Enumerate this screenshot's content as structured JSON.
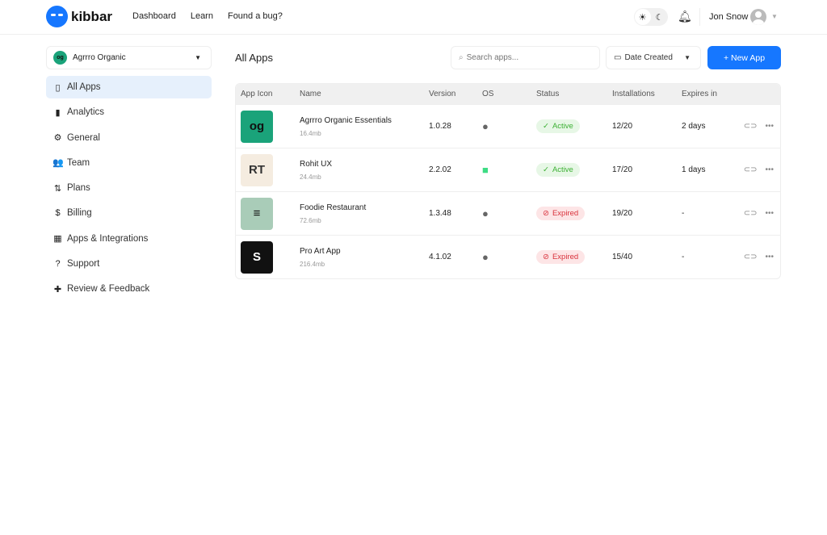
{
  "header": {
    "brand": "kibbar",
    "nav": [
      "Dashboard",
      "Learn",
      "Found a bug?"
    ],
    "user_name": "Jon Snow"
  },
  "org": {
    "name": "Agrrro Organic",
    "logo_text": "og"
  },
  "sidebar": {
    "items": [
      {
        "label": "All Apps",
        "icon": "phone-icon",
        "glyph": "▯",
        "active": true
      },
      {
        "label": "Analytics",
        "icon": "bar-chart-icon",
        "glyph": "▮"
      },
      {
        "label": "General",
        "icon": "gear-icon",
        "glyph": "⚙"
      },
      {
        "label": "Team",
        "icon": "team-icon",
        "glyph": "👥"
      },
      {
        "label": "Plans",
        "icon": "swap-icon",
        "glyph": "⇅"
      },
      {
        "label": "Billing",
        "icon": "dollar-icon",
        "glyph": "$"
      },
      {
        "label": "Apps & Integrations",
        "icon": "apps-icon",
        "glyph": "▦"
      },
      {
        "label": "Support",
        "icon": "help-icon",
        "glyph": "?"
      },
      {
        "label": "Review & Feedback",
        "icon": "feedback-icon",
        "glyph": "✚"
      }
    ]
  },
  "main": {
    "title": "All Apps",
    "search_placeholder": "Search apps...",
    "sort_label": "Date Created",
    "new_app_label": "+ New App",
    "columns": [
      "App Icon",
      "Name",
      "Version",
      "OS",
      "Status",
      "Installations",
      "Expires in"
    ],
    "rows": [
      {
        "name": "Agrrro Organic Essentials",
        "size": "16.4mb",
        "version": "1.0.28",
        "os": "ios",
        "status": "Active",
        "installs": "12/20",
        "expires": "2 days",
        "icon_text": "og",
        "icon_bg": "#1aa37a"
      },
      {
        "name": "Rohit UX",
        "size": "24.4mb",
        "version": "2.2.02",
        "os": "android",
        "status": "Active",
        "installs": "17/20",
        "expires": "1 days",
        "icon_text": "RT",
        "icon_bg": "#f5ece0"
      },
      {
        "name": "Foodie Restaurant",
        "size": "72.6mb",
        "version": "1.3.48",
        "os": "ios",
        "status": "Expired",
        "installs": "19/20",
        "expires": "-",
        "icon_text": "≡",
        "icon_bg": "#a9ccb8"
      },
      {
        "name": "Pro Art App",
        "size": "216.4mb",
        "version": "4.1.02",
        "os": "ios",
        "status": "Expired",
        "installs": "15/40",
        "expires": "-",
        "icon_text": "S",
        "icon_bg": "#111111"
      }
    ]
  },
  "colors": {
    "accent": "#1677ff",
    "active": "#3cb034",
    "expired": "#d9323c",
    "android": "#3ddc84"
  }
}
